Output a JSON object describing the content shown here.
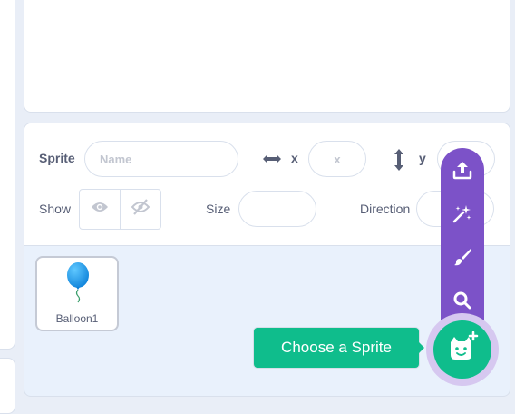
{
  "sprite_info": {
    "sprite_label": "Sprite",
    "name_placeholder": "Name",
    "x_label": "x",
    "x_placeholder": "x",
    "y_label": "y",
    "show_label": "Show",
    "size_label": "Size",
    "direction_label": "Direction"
  },
  "sprites": [
    {
      "name": "Balloon1"
    }
  ],
  "sprite_menu": {
    "items": [
      {
        "icon": "upload-icon"
      },
      {
        "icon": "surprise-icon"
      },
      {
        "icon": "paint-icon"
      },
      {
        "icon": "search-icon"
      }
    ],
    "main_icon": "cat-plus-icon",
    "tooltip": "Choose a Sprite"
  },
  "colors": {
    "menu_purple": "#7c52c8",
    "fab_green": "#0fbd8c",
    "text": "#575e75"
  }
}
